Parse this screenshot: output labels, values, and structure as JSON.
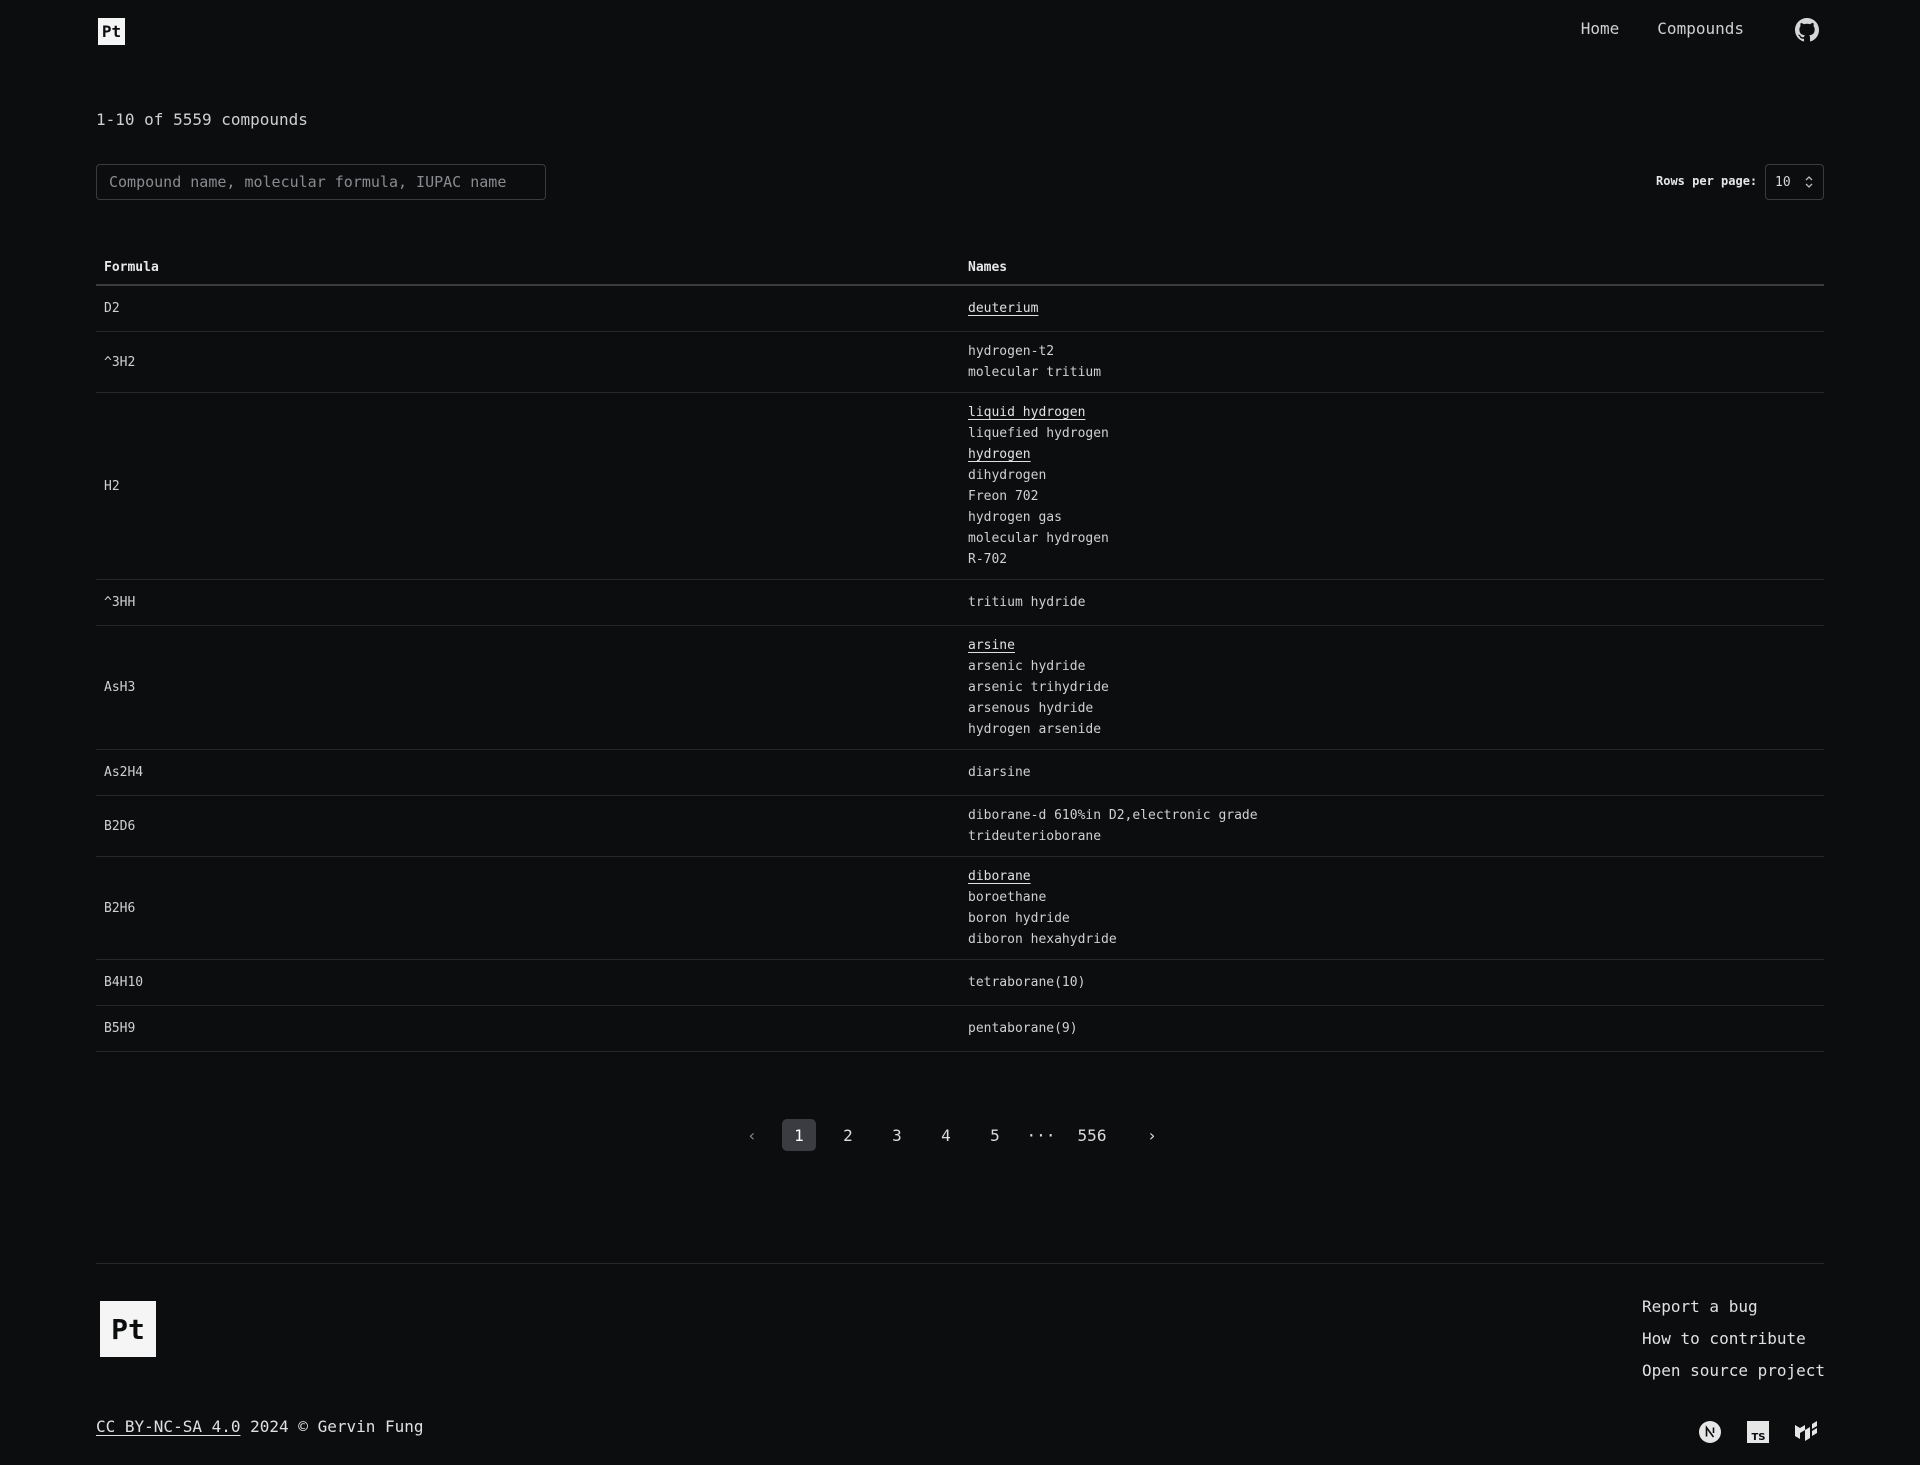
{
  "header": {
    "logo_text": "Pt",
    "nav": [
      {
        "label": "Home"
      },
      {
        "label": "Compounds"
      }
    ],
    "github_icon": "github-icon"
  },
  "results": {
    "count_text": "1-10 of 5559 compounds"
  },
  "search": {
    "placeholder": "Compound name, molecular formula, IUPAC name",
    "value": ""
  },
  "rows_per_page": {
    "label": "Rows per page:",
    "value": "10"
  },
  "table": {
    "columns": [
      "Formula",
      "Names"
    ],
    "rows": [
      {
        "formula": "D2",
        "names": [
          {
            "text": "deuterium",
            "link": true
          }
        ]
      },
      {
        "formula": "^3H2",
        "names": [
          {
            "text": "hydrogen-t2",
            "link": false
          },
          {
            "text": "molecular tritium",
            "link": false
          }
        ]
      },
      {
        "formula": "H2",
        "names": [
          {
            "text": "liquid hydrogen",
            "link": true
          },
          {
            "text": "liquefied hydrogen",
            "link": false
          },
          {
            "text": "hydrogen",
            "link": true
          },
          {
            "text": "dihydrogen",
            "link": false
          },
          {
            "text": "Freon 702",
            "link": false
          },
          {
            "text": "hydrogen gas",
            "link": false
          },
          {
            "text": "molecular hydrogen",
            "link": false
          },
          {
            "text": "R-702",
            "link": false
          }
        ]
      },
      {
        "formula": "^3HH",
        "names": [
          {
            "text": "tritium hydride",
            "link": false
          }
        ]
      },
      {
        "formula": "AsH3",
        "names": [
          {
            "text": "arsine",
            "link": true
          },
          {
            "text": "arsenic hydride",
            "link": false
          },
          {
            "text": "arsenic trihydride",
            "link": false
          },
          {
            "text": "arsenous hydride",
            "link": false
          },
          {
            "text": "hydrogen arsenide",
            "link": false
          }
        ]
      },
      {
        "formula": "As2H4",
        "names": [
          {
            "text": "diarsine",
            "link": false
          }
        ]
      },
      {
        "formula": "B2D6",
        "names": [
          {
            "text": "diborane-d 610%in D2,electronic grade",
            "link": false
          },
          {
            "text": "trideuterioborane",
            "link": false
          }
        ]
      },
      {
        "formula": "B2H6",
        "names": [
          {
            "text": "diborane",
            "link": true
          },
          {
            "text": "boroethane",
            "link": false
          },
          {
            "text": "boron hydride",
            "link": false
          },
          {
            "text": "diboron hexahydride",
            "link": false
          }
        ]
      },
      {
        "formula": "B4H10",
        "names": [
          {
            "text": "tetraborane(10)",
            "link": false
          }
        ]
      },
      {
        "formula": "B5H9",
        "names": [
          {
            "text": "pentaborane(9)",
            "link": false
          }
        ]
      }
    ]
  },
  "pagination": {
    "prev": "‹",
    "pages": [
      "1",
      "2",
      "3",
      "4",
      "5"
    ],
    "ellipsis": "···",
    "last": "556",
    "next": "›",
    "current": "1"
  },
  "footer": {
    "logo_text": "Pt",
    "links": [
      "Report a bug",
      "How to contribute",
      "Open source project"
    ],
    "license": "CC BY-NC-SA 4.0",
    "copyright": " 2024 © Gervin Fung",
    "tech_icons": [
      "nextjs-icon",
      "typescript-icon",
      "mui-icon"
    ]
  }
}
